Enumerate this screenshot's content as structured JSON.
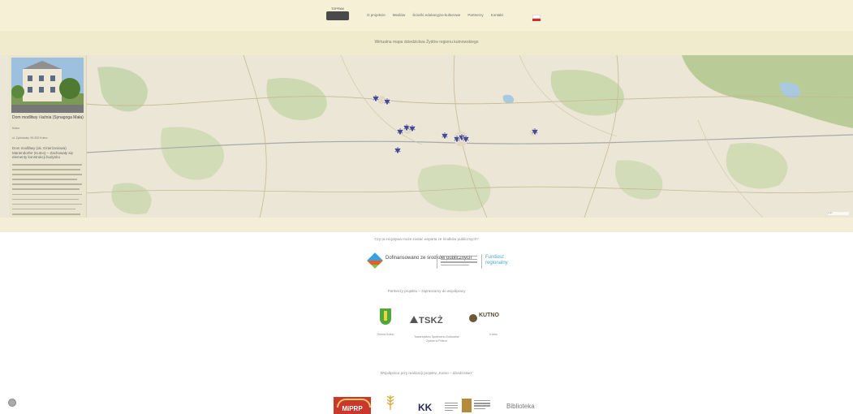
{
  "header": {
    "logo_text": "TOPRAK",
    "nav": [
      "O projekcie",
      "Mediów",
      "Ścieżki edukacyjno-kulturowe",
      "Partnerzy",
      "Kontakt"
    ],
    "subtitle": "Wirtualna mapa dziedzictwa Żydów regionu kutnowskiego"
  },
  "map": {
    "marker_icon": "star-of-david-icon",
    "marker_color": "#4a4a8a"
  },
  "panel": {
    "title": "Dom modlitwy i łaźnia (Synagoga Mała)",
    "meta": "Kutno",
    "address": "ul. Żydowska, 99-300 Kutno",
    "description": "Dom modlitwy (ok. Dzierżoniowa) Mariendorfer (Kutno) – Zachowały się elementy konstrukcji budynku",
    "scale_label": "1 km"
  },
  "sections": {
    "q1": "Czy ta inicjatywa może zostać wsparta ze środków publicznych?",
    "partner1_text": "Dofinansowano ze środków publicznych",
    "partner1_right": "Fundusz regionalny",
    "q2": "Partnerzy projektu – zapraszamy do współpracy",
    "caption_gmina": "Gmina Kutno",
    "caption_tskz": "Towarzystwo Społeczno-Kulturalne Żydów w Polsce",
    "caption_kutno": "Kutno",
    "q3": "Współpraca przy realizacji projektu „Kutno – dziedzictwo”",
    "kutno_logo": "KUTNO",
    "tskz_logo": "TSKŻ",
    "miprp_logo": "MiPRP",
    "kk_logo": "KK",
    "biblio_logo": "Biblioteka"
  },
  "colors": {
    "header_bg": "#f5f0d6",
    "subbar_bg": "#f1ebce",
    "marker": "#4a4a8a"
  }
}
